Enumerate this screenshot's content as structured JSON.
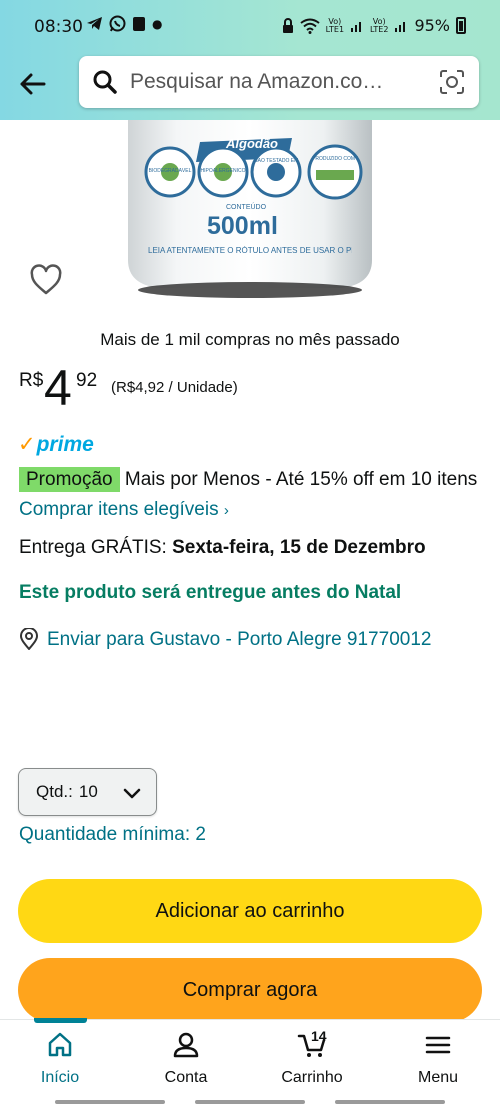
{
  "status_bar": {
    "time": "08:30",
    "battery": "95%",
    "lte1": "LTE1",
    "lte2": "LTE2",
    "vo1": "Vo)",
    "vo2": "Vo)"
  },
  "search": {
    "placeholder": "Pesquisar na Amazon.co…"
  },
  "product_image": {
    "label_algodao": "Algodão",
    "badges": [
      "HIPOALERGÊNICO",
      "NÃO TESTADO EM ANIMAIS",
      "PRODUZIDO COM ÁLCOOL ORGÂNICO",
      "BIODEGRADÁVEL"
    ],
    "conteudo": "CONTEÚDO",
    "volume": "500ml",
    "warning": "LEIA ATENTAMENTE O RÓTULO ANTES DE USAR O PRODUTO"
  },
  "monthly_purchases": "Mais de 1 mil compras no mês passado",
  "price": {
    "symbol": "R$",
    "whole": "4",
    "fraction": "92",
    "unit_price": "(R$4,92 / Unidade)"
  },
  "prime": {
    "check": "✓",
    "label": "prime"
  },
  "promotion": {
    "badge": "Promoção",
    "text": "Mais por Menos - Até 15% off em 10 itens",
    "link": "Comprar itens elegíveis",
    "link_chevron": "›"
  },
  "delivery": {
    "prefix": "Entrega GRÁTIS:",
    "date": "Sexta-feira, 15 de Dezembro"
  },
  "christmas_notice": "Este produto será entregue antes do Natal",
  "location": {
    "text": "Enviar para Gustavo - Porto Alegre 91770012"
  },
  "quantity": {
    "label": "Qtd.:",
    "value": "10",
    "minimum": "Quantidade mínima: 2"
  },
  "buttons": {
    "add_to_cart": "Adicionar ao carrinho",
    "buy_now": "Comprar agora"
  },
  "bottom_nav": {
    "home": "Início",
    "account": "Conta",
    "cart": "Carrinho",
    "cart_count": "14",
    "menu": "Menu"
  },
  "colors": {
    "header_gradient_start": "#84d8e3",
    "header_gradient_end": "#a5e6cf",
    "add_to_cart": "#ffd814",
    "buy_now": "#ffa41c",
    "link": "#007185",
    "promo_badge": "#7fda69",
    "christmas_green": "#067d62",
    "prime_blue": "#00a8e1"
  }
}
